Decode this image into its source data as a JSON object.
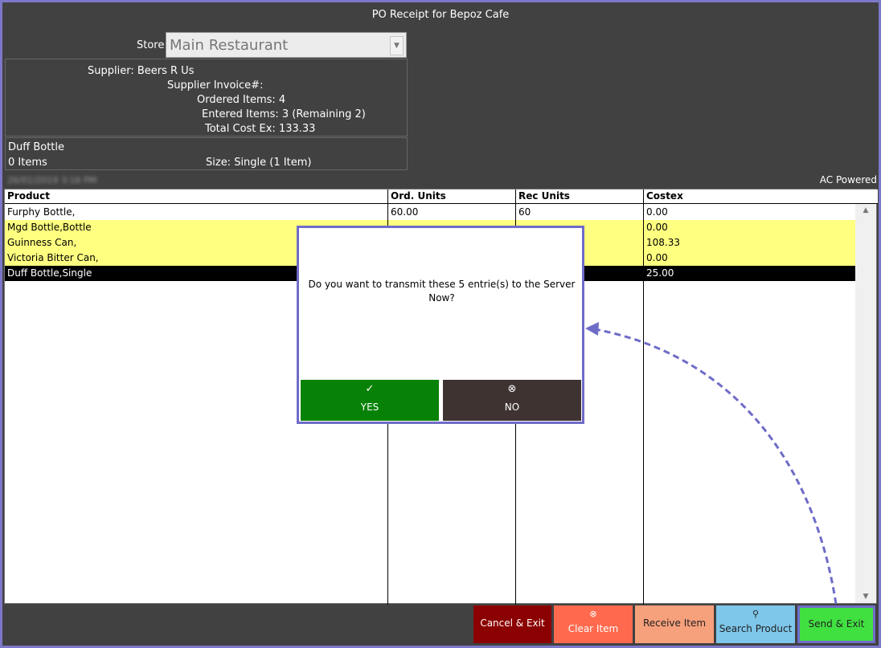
{
  "window": {
    "title": "PO Receipt for Bepoz Cafe"
  },
  "store": {
    "label": "Store:",
    "value": "Main Restaurant"
  },
  "summary": {
    "supplier": "Supplier: Beers R Us",
    "supplier_invoice": "Supplier Invoice#:",
    "ordered_items": "Ordered Items: 4",
    "entered_items": "Entered Items: 3 (Remaining 2)",
    "total_cost": "Total Cost Ex: 133.33"
  },
  "current_item": {
    "name": "Duff Bottle",
    "count": "0 Items",
    "size": "Size: Single (1 Item)"
  },
  "status": {
    "date": "26/01/2019 3:16 PM",
    "power": "AC Powered"
  },
  "grid": {
    "columns": [
      "Product",
      "Ord. Units",
      "Rec Units",
      "Costex"
    ],
    "rows": [
      {
        "product": "Furphy Bottle,",
        "ord": "60.00",
        "rec": "60",
        "costex": "0.00",
        "style": "white"
      },
      {
        "product": "Mgd Bottle,Bottle",
        "ord": "",
        "rec": "",
        "costex": "0.00",
        "style": "yellow"
      },
      {
        "product": "Guinness Can,",
        "ord": "",
        "rec": "",
        "costex": "108.33",
        "style": "yellow"
      },
      {
        "product": "Victoria Bitter Can,",
        "ord": "",
        "rec": "",
        "costex": "0.00",
        "style": "yellow"
      },
      {
        "product": "Duff Bottle,Single",
        "ord": "",
        "rec": "",
        "costex": "25.00",
        "style": "black"
      }
    ]
  },
  "dialog": {
    "message": "Do you want to transmit these 5 entrie(s) to the Server Now?",
    "yes_label": "YES",
    "no_label": "NO"
  },
  "buttons": {
    "cancel_exit": "Cancel & Exit",
    "clear_item": "Clear Item",
    "receive_item": "Receive Item",
    "search_product": "Search Product",
    "send_exit": "Send & Exit"
  },
  "colors": {
    "accent": "#6f6cc8",
    "yes": "#078207",
    "no": "#3f3332",
    "cancel": "#8b0000",
    "clear": "#ff6a4e",
    "receive": "#f7a07c",
    "search": "#7ec6ea",
    "send": "#41e041",
    "highlight_row": "#ffff80"
  }
}
